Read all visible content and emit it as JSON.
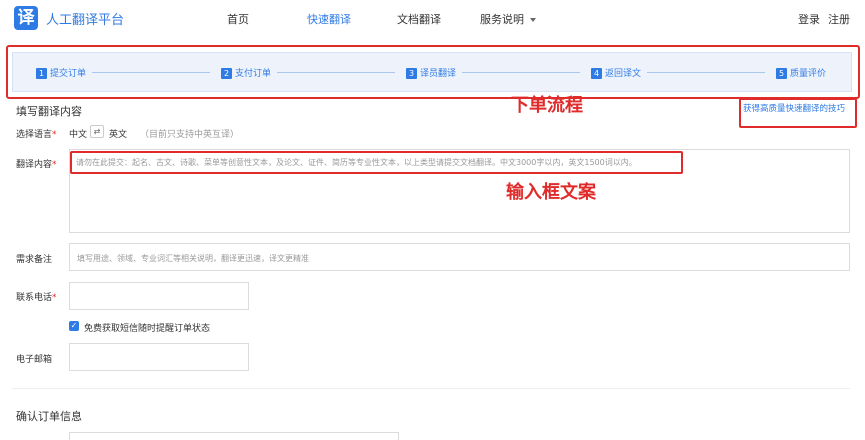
{
  "header": {
    "logo_char": "译",
    "brand": "人工翻译平台",
    "nav": [
      "首页",
      "快速翻译",
      "文档翻译",
      "服务说明"
    ],
    "login": "登录",
    "register": "注册"
  },
  "steps": [
    {
      "num": "1",
      "label": "提交订单"
    },
    {
      "num": "2",
      "label": "支付订单"
    },
    {
      "num": "3",
      "label": "译员翻译"
    },
    {
      "num": "4",
      "label": "返回译文"
    },
    {
      "num": "5",
      "label": "质量评价"
    }
  ],
  "annotations": {
    "flow": "下单流程",
    "input": "输入框文案"
  },
  "form": {
    "section_title": "填写翻译内容",
    "tip_link": "获得高质量快速翻译的技巧",
    "language_label": "选择语言",
    "source_lang": "中文",
    "swap_icon": "⇄",
    "target_lang": "英文",
    "language_note": "（目前只支持中英互译）",
    "content_label": "翻译内容",
    "content_placeholder": "请勿在此提交：起名、古文、诗歌、菜单等创意性文本，及论文、证件、简历等专业性文本，以上类型请提交文档翻译。中文3000字以内，英文1500词以内。",
    "remark_label": "需求备注",
    "remark_placeholder": "填写用途、领域、专业词汇等相关说明，翻译更迅速，译文更精准",
    "phone_label": "联系电话",
    "sms_checkbox": "免费获取短信随时提醒订单状态",
    "email_label": "电子邮箱",
    "required_mark": "*"
  },
  "confirm": {
    "title": "确认订单信息"
  }
}
